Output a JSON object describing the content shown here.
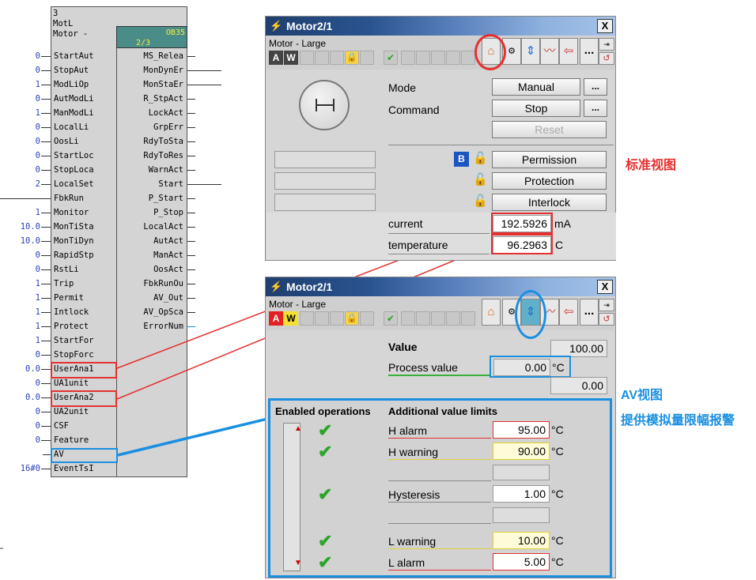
{
  "fblock": {
    "number": "3",
    "type": "MotL",
    "name": "Motor -",
    "ob_top": "OB35",
    "ob_bottom": "2/3",
    "inputs": [
      {
        "value": "0",
        "name": "StartAut"
      },
      {
        "value": "0",
        "name": "StopAut"
      },
      {
        "value": "1",
        "name": "ModLiOp"
      },
      {
        "value": "0",
        "name": "AutModLi"
      },
      {
        "value": "1",
        "name": "ManModLi"
      },
      {
        "value": "0",
        "name": "LocalLi"
      },
      {
        "value": "0",
        "name": "OosLi"
      },
      {
        "value": "0",
        "name": "StartLoc"
      },
      {
        "value": "0",
        "name": "StopLoca"
      },
      {
        "value": "2",
        "name": "LocalSet"
      },
      {
        "value": "",
        "name": "FbkRun"
      },
      {
        "value": "1",
        "name": "Monitor"
      },
      {
        "value": "10.0",
        "name": "MonTiSta"
      },
      {
        "value": "10.0",
        "name": "MonTiDyn"
      },
      {
        "value": "0",
        "name": "RapidStp"
      },
      {
        "value": "0",
        "name": "RstLi"
      },
      {
        "value": "1",
        "name": "Trip"
      },
      {
        "value": "1",
        "name": "Permit"
      },
      {
        "value": "1",
        "name": "Intlock"
      },
      {
        "value": "1",
        "name": "Protect"
      },
      {
        "value": "1",
        "name": "StartFor"
      },
      {
        "value": "0",
        "name": "StopForc"
      },
      {
        "value": "0.0",
        "name": "UserAna1"
      },
      {
        "value": "0",
        "name": "UA1unit"
      },
      {
        "value": "0.0",
        "name": "UserAna2"
      },
      {
        "value": "0",
        "name": "UA2unit"
      },
      {
        "value": "0",
        "name": "CSF"
      },
      {
        "value": "0",
        "name": "Feature"
      },
      {
        "value": "",
        "name": "AV"
      },
      {
        "value": "16#0",
        "name": "EventTsI"
      }
    ],
    "outputs": [
      "MS_Relea",
      "MonDynEr",
      "MonStaEr",
      "R_StpAct",
      "LockAct",
      "GrpErr",
      "RdyToSta",
      "RdyToRes",
      "WarnAct",
      "Start",
      "P_Start",
      "P_Stop",
      "LocalAct",
      "AutAct",
      "ManAct",
      "OosAct",
      "FbkRunOu",
      "AV_Out",
      "AV_OpSca",
      "ErrorNum"
    ]
  },
  "std": {
    "title": "Motor2/1",
    "close": "X",
    "subtitle": "Motor - Large",
    "badge_a": "A",
    "badge_w": "W",
    "mode_label": "Mode",
    "mode_value": "Manual",
    "command_label": "Command",
    "command_value": "Stop",
    "reset_label": "Reset",
    "more": "...",
    "b_badge": "B",
    "permission": "Permission",
    "protection": "Protection",
    "interlock": "Interlock",
    "current_label": "current",
    "current_value": "192.5926",
    "current_unit": "mA",
    "temp_label": "temperature",
    "temp_value": "96.2963",
    "temp_unit": "C"
  },
  "av": {
    "title": "Motor2/1",
    "close": "X",
    "subtitle": "Motor - Large",
    "badge_a": "A",
    "badge_w": "W",
    "more": "...",
    "value_label": "Value",
    "value_value": "100.00",
    "process_label": "Process value",
    "process_value": "0.00",
    "process_unit": "°C",
    "third_value": "0.00",
    "enabled_ops": "Enabled operations",
    "add_limits": "Additional value limits",
    "h_alarm_label": "H alarm",
    "h_alarm_value": "95.00",
    "h_warning_label": "H warning",
    "h_warning_value": "90.00",
    "hyst_label": "Hysteresis",
    "hyst_value": "1.00",
    "l_warning_label": "L warning",
    "l_warning_value": "10.00",
    "l_alarm_label": "L alarm",
    "l_alarm_value": "5.00",
    "unit": "°C"
  },
  "annotations": {
    "standard_view": "标准视图",
    "av_view": "AV视图",
    "av_desc": "提供模拟量限幅报警"
  },
  "colors": {
    "highlight_red": "#e53030",
    "highlight_blue": "#1a8fe0",
    "check_green": "#2ba52b"
  }
}
